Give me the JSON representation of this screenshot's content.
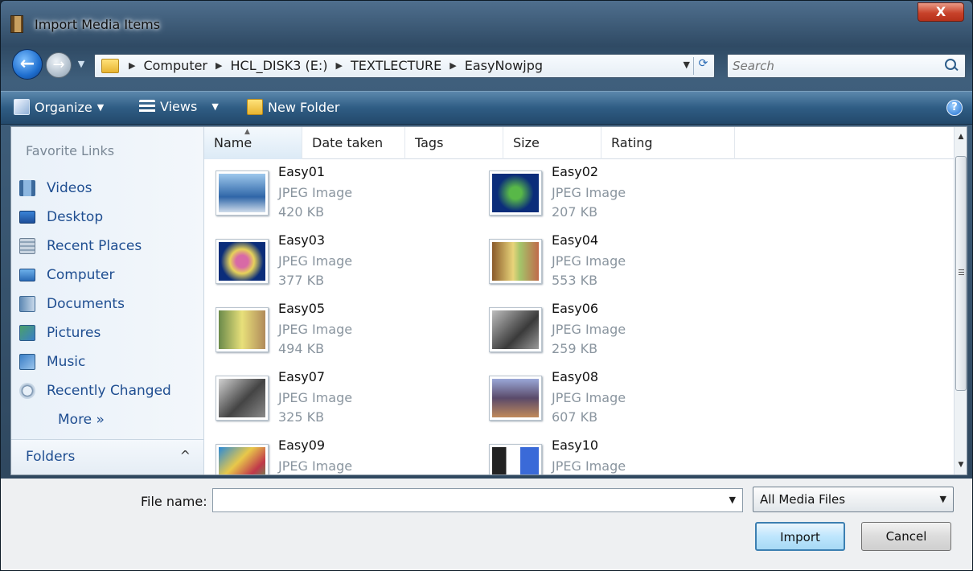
{
  "window": {
    "title": "Import Media Items",
    "close_label": "X"
  },
  "address": {
    "breadcrumbs": [
      "Computer",
      "HCL_DISK3 (E:)",
      "TEXTLECTURE",
      "EasyNowjpg"
    ],
    "separator": "▶",
    "search_placeholder": "Search"
  },
  "toolbar": {
    "organize": "Organize",
    "views": "Views",
    "new_folder": "New Folder",
    "help": "?"
  },
  "nav": {
    "heading": "Favorite Links",
    "items": [
      {
        "label": "Videos",
        "icon": "videos-icon"
      },
      {
        "label": "Desktop",
        "icon": "desktop-icon"
      },
      {
        "label": "Recent Places",
        "icon": "recent-places-icon"
      },
      {
        "label": "Computer",
        "icon": "computer-icon"
      },
      {
        "label": "Documents",
        "icon": "documents-icon"
      },
      {
        "label": "Pictures",
        "icon": "pictures-icon"
      },
      {
        "label": "Music",
        "icon": "music-icon"
      },
      {
        "label": "Recently Changed",
        "icon": "recently-changed-icon"
      }
    ],
    "more": "More »",
    "folders": "Folders",
    "folders_chevron": "^"
  },
  "columns": [
    "Name",
    "Date taken",
    "Tags",
    "Size",
    "Rating"
  ],
  "files": [
    {
      "name": "Easy01",
      "type": "JPEG Image",
      "size": "420 KB"
    },
    {
      "name": "Easy02",
      "type": "JPEG Image",
      "size": "207 KB"
    },
    {
      "name": "Easy03",
      "type": "JPEG Image",
      "size": "377 KB"
    },
    {
      "name": "Easy04",
      "type": "JPEG Image",
      "size": "553 KB"
    },
    {
      "name": "Easy05",
      "type": "JPEG Image",
      "size": "494 KB"
    },
    {
      "name": "Easy06",
      "type": "JPEG Image",
      "size": "259 KB"
    },
    {
      "name": "Easy07",
      "type": "JPEG Image",
      "size": "325 KB"
    },
    {
      "name": "Easy08",
      "type": "JPEG Image",
      "size": "607 KB"
    },
    {
      "name": "Easy09",
      "type": "JPEG Image",
      "size": ""
    },
    {
      "name": "Easy10",
      "type": "JPEG Image",
      "size": ""
    }
  ],
  "bottom": {
    "file_name_label": "File name:",
    "file_name_value": "",
    "filter": "All Media Files",
    "import": "Import",
    "cancel": "Cancel"
  },
  "colors": {
    "accent": "#1f4e91",
    "toolbar": "#2f5d84",
    "import_border": "#3c7fb1"
  }
}
